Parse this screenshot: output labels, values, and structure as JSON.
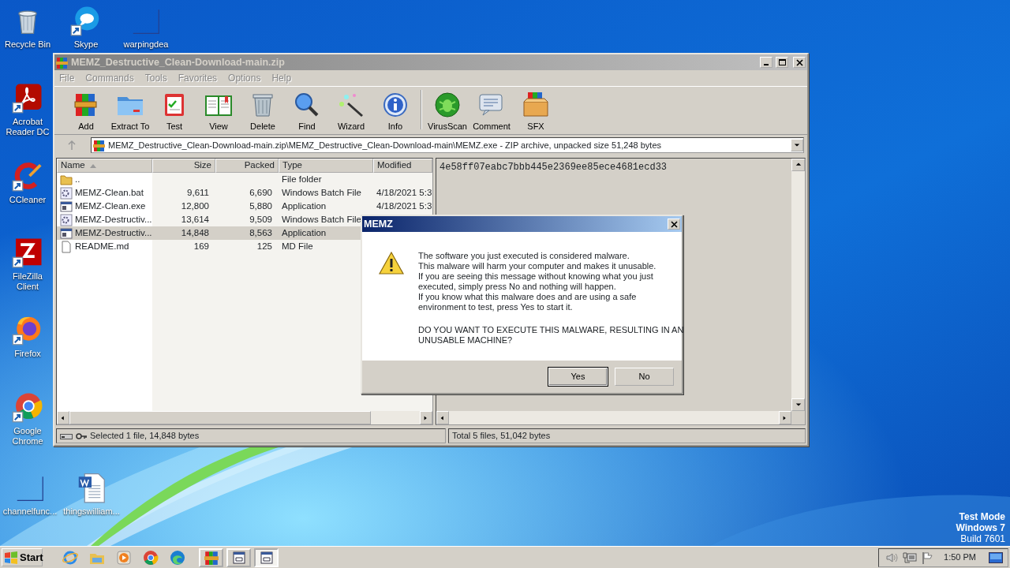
{
  "desktop": {
    "icons": [
      {
        "label": "Recycle Bin",
        "kind": "trash"
      },
      {
        "label": "Skype",
        "kind": "chat"
      },
      {
        "label": "warpingdea",
        "kind": "blank"
      },
      {
        "label": "Acrobat Reader DC",
        "kind": "acrobat"
      },
      {
        "label": "CCleaner",
        "kind": "ccleaner"
      },
      {
        "label": "FileZilla Client",
        "kind": "filezilla"
      },
      {
        "label": "Firefox",
        "kind": "firefox"
      },
      {
        "label": "Google Chrome",
        "kind": "chrome"
      },
      {
        "label": "channelfunc...",
        "kind": "blank"
      },
      {
        "label": "thingswilliam...",
        "kind": "word"
      }
    ],
    "os_info": [
      "Test Mode",
      "Windows 7",
      "Build 7601"
    ]
  },
  "winrar": {
    "title": "MEMZ_Destructive_Clean-Download-main.zip",
    "active": false,
    "menu": [
      {
        "label": "File",
        "disabled": true
      },
      {
        "label": "Commands",
        "disabled": true
      },
      {
        "label": "Tools",
        "disabled": true
      },
      {
        "label": "Favorites",
        "disabled": true
      },
      {
        "label": "Options",
        "disabled": true
      },
      {
        "label": "Help",
        "disabled": true
      }
    ],
    "toolbar_groups": [
      [
        {
          "label": "Add",
          "kind": "add"
        },
        {
          "label": "Extract To",
          "kind": "extract"
        },
        {
          "label": "Test",
          "kind": "test"
        },
        {
          "label": "View",
          "kind": "view"
        },
        {
          "label": "Delete",
          "kind": "delete"
        },
        {
          "label": "Find",
          "kind": "find"
        },
        {
          "label": "Wizard",
          "kind": "wizard"
        },
        {
          "label": "Info",
          "kind": "info"
        }
      ],
      [
        {
          "label": "VirusScan",
          "kind": "virusscan"
        },
        {
          "label": "Comment",
          "kind": "comment"
        },
        {
          "label": "SFX",
          "kind": "sfx"
        }
      ]
    ],
    "address": "MEMZ_Destructive_Clean-Download-main.zip\\MEMZ_Destructive_Clean-Download-main\\MEMZ.exe - ZIP archive, unpacked size 51,248 bytes",
    "columns": [
      {
        "label": "Name",
        "sorted": true
      },
      {
        "label": "Size",
        "sorted": false
      },
      {
        "label": "Packed",
        "sorted": false
      },
      {
        "label": "Type",
        "sorted": false
      },
      {
        "label": "Modified",
        "sorted": false
      }
    ],
    "rows": [
      {
        "kind": "folder",
        "name": "..",
        "type": "File folder",
        "selected": false
      },
      {
        "kind": "batch",
        "name": "MEMZ-Clean.bat",
        "size": "9,611",
        "packed": "6,690",
        "type": "Windows Batch File",
        "modified": "4/18/2021 5:3",
        "selected": false
      },
      {
        "kind": "app",
        "name": "MEMZ-Clean.exe",
        "size": "12,800",
        "packed": "5,880",
        "type": "Application",
        "modified": "4/18/2021 5:3",
        "selected": false
      },
      {
        "kind": "batch",
        "name": "MEMZ-Destructiv...",
        "size": "13,614",
        "packed": "9,509",
        "type": "Windows Batch File",
        "selected": false
      },
      {
        "kind": "app",
        "name": "MEMZ-Destructiv...",
        "size": "14,848",
        "packed": "8,563",
        "type": "Application",
        "selected": true
      },
      {
        "kind": "doc",
        "name": "README.md",
        "size": "169",
        "packed": "125",
        "type": "MD File",
        "selected": false
      }
    ],
    "comment": "4e58ff07eabc7bbb445e2369ee85ece4681ecd33",
    "status": [
      "Selected 1 file, 14,848 bytes",
      "Total 5 files, 51,042 bytes"
    ]
  },
  "dialog": {
    "title": "MEMZ",
    "active": true,
    "message": "The software you just executed is considered malware.\nThis malware will harm your computer and makes it unusable.\nIf you are seeing this message without knowing what you just\nexecuted, simply press No and nothing will happen.\nIf you know what this malware does and are using a safe\nenvironment to test, press Yes to start it.",
    "question": "DO YOU WANT TO EXECUTE THIS MALWARE, RESULTING IN AN\nUNUSABLE MACHINE?",
    "buttons": [
      {
        "label": "Yes",
        "default": true
      },
      {
        "label": "No",
        "default": false
      }
    ]
  },
  "taskbar": {
    "start": "Start",
    "tasks": [
      {
        "kind": "archive",
        "selected": false
      },
      {
        "kind": "window",
        "selected": false
      },
      {
        "kind": "window",
        "selected": true
      }
    ],
    "clock": "1:50 PM"
  }
}
